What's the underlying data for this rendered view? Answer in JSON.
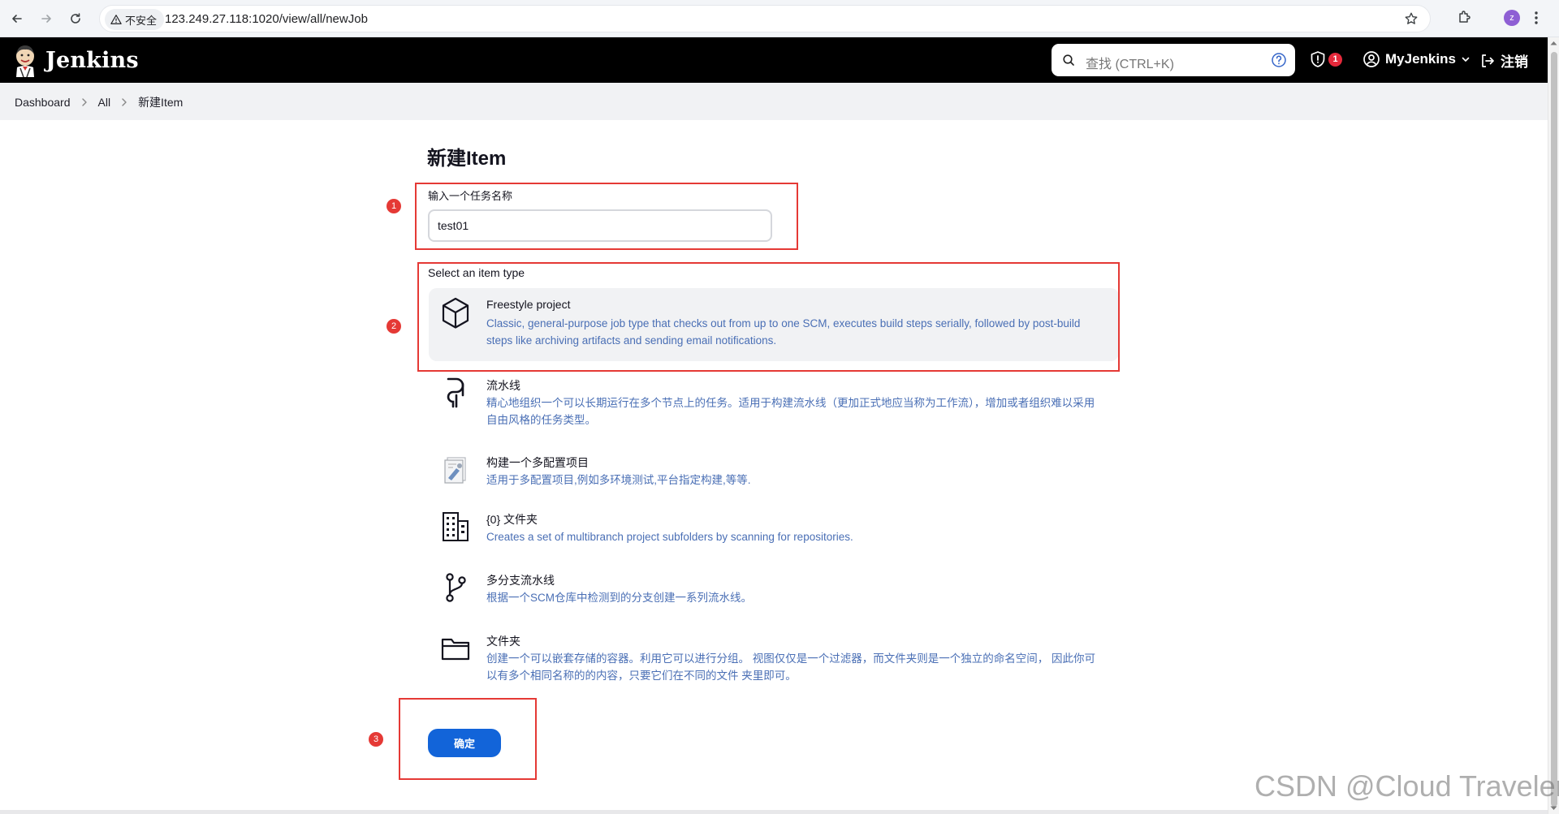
{
  "browser": {
    "security_label": "不安全",
    "url": "123.249.27.118:1020/view/all/newJob",
    "profile_initial": "z"
  },
  "header": {
    "brand": "Jenkins",
    "search_placeholder": "查找 (CTRL+K)",
    "security_count": "1",
    "user": "MyJenkins",
    "logout": "注销"
  },
  "breadcrumb": [
    "Dashboard",
    "All",
    "新建Item"
  ],
  "page": {
    "title": "新建Item",
    "name_label": "输入一个任务名称",
    "name_value": "test01",
    "type_label": "Select an item type",
    "ok_label": "确定"
  },
  "item_types": [
    {
      "name": "Freestyle project",
      "icon": "package-icon",
      "desc": "Classic, general-purpose job type that checks out from up to one SCM, executes build steps serially, followed by post-build steps like archiving artifacts and sending email notifications.",
      "selected": true
    },
    {
      "name": "流水线",
      "icon": "pipeline-icon",
      "desc": "精心地组织一个可以长期运行在多个节点上的任务。适用于构建流水线（更加正式地应当称为工作流），增加或者组织难以采用自由风格的任务类型。"
    },
    {
      "name": "构建一个多配置项目",
      "icon": "multi-config-icon",
      "desc": "适用于多配置项目,例如多环境测试,平台指定构建,等等."
    },
    {
      "name": "{0} 文件夹",
      "icon": "organization-icon",
      "desc": "Creates a set of multibranch project subfolders by scanning for repositories."
    },
    {
      "name": "多分支流水线",
      "icon": "branch-icon",
      "desc": "根据一个SCM仓库中检测到的分支创建一系列流水线。"
    },
    {
      "name": "文件夹",
      "icon": "folder-icon",
      "desc": "创建一个可以嵌套存储的容器。利用它可以进行分组。 视图仅仅是一个过滤器，而文件夹则是一个独立的命名空间， 因此你可以有多个相同名称的的内容，只要它们在不同的文件 夹里即可。"
    }
  ],
  "annotations": [
    "1",
    "2",
    "3"
  ],
  "watermark": "CSDN @Cloud Traveler",
  "colors": {
    "accent": "#1264d9",
    "header_bg": "#000000",
    "annotation": "#e53935",
    "desc_text": "#4a6fb5"
  }
}
